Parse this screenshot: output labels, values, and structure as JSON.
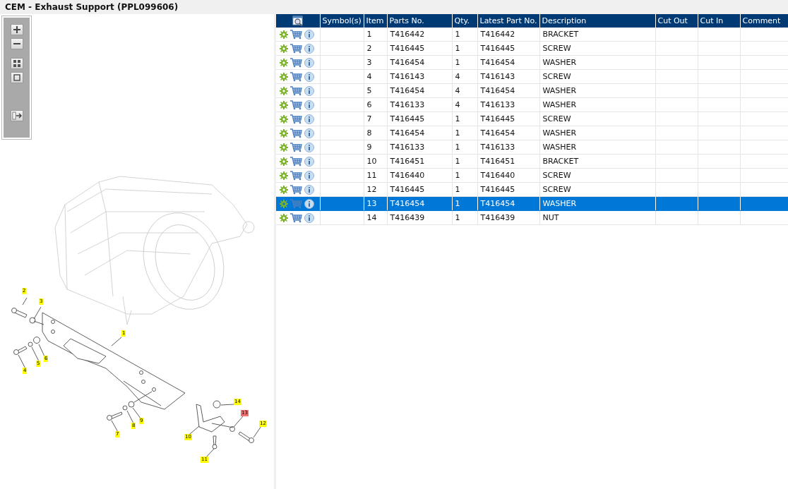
{
  "window": {
    "title": "CEM - Exhaust Support (PPL099606)"
  },
  "diagram": {
    "callouts": [
      {
        "label": "1",
        "selected": false
      },
      {
        "label": "2",
        "selected": false
      },
      {
        "label": "3",
        "selected": false
      },
      {
        "label": "4",
        "selected": false
      },
      {
        "label": "5",
        "selected": false
      },
      {
        "label": "6",
        "selected": false
      },
      {
        "label": "7",
        "selected": false
      },
      {
        "label": "8",
        "selected": false
      },
      {
        "label": "9",
        "selected": false
      },
      {
        "label": "10",
        "selected": false
      },
      {
        "label": "11",
        "selected": false
      },
      {
        "label": "12",
        "selected": false
      },
      {
        "label": "13",
        "selected": true
      },
      {
        "label": "14",
        "selected": false
      }
    ]
  },
  "table": {
    "columns": [
      "Symbol(s)",
      "Item",
      "Parts No.",
      "Qty.",
      "Latest Part No.",
      "Description",
      "Cut Out",
      "Cut In",
      "Comment"
    ],
    "rows": [
      {
        "item": "1",
        "part_no": "T416442",
        "qty": "1",
        "latest_part_no": "T416442",
        "description": "BRACKET",
        "selected": false
      },
      {
        "item": "2",
        "part_no": "T416445",
        "qty": "1",
        "latest_part_no": "T416445",
        "description": "SCREW",
        "selected": false
      },
      {
        "item": "3",
        "part_no": "T416454",
        "qty": "1",
        "latest_part_no": "T416454",
        "description": "WASHER",
        "selected": false
      },
      {
        "item": "4",
        "part_no": "T416143",
        "qty": "4",
        "latest_part_no": "T416143",
        "description": "SCREW",
        "selected": false
      },
      {
        "item": "5",
        "part_no": "T416454",
        "qty": "4",
        "latest_part_no": "T416454",
        "description": "WASHER",
        "selected": false
      },
      {
        "item": "6",
        "part_no": "T416133",
        "qty": "4",
        "latest_part_no": "T416133",
        "description": "WASHER",
        "selected": false
      },
      {
        "item": "7",
        "part_no": "T416445",
        "qty": "1",
        "latest_part_no": "T416445",
        "description": "SCREW",
        "selected": false
      },
      {
        "item": "8",
        "part_no": "T416454",
        "qty": "1",
        "latest_part_no": "T416454",
        "description": "WASHER",
        "selected": false
      },
      {
        "item": "9",
        "part_no": "T416133",
        "qty": "1",
        "latest_part_no": "T416133",
        "description": "WASHER",
        "selected": false
      },
      {
        "item": "10",
        "part_no": "T416451",
        "qty": "1",
        "latest_part_no": "T416451",
        "description": "BRACKET",
        "selected": false
      },
      {
        "item": "11",
        "part_no": "T416440",
        "qty": "1",
        "latest_part_no": "T416440",
        "description": "SCREW",
        "selected": false
      },
      {
        "item": "12",
        "part_no": "T416445",
        "qty": "1",
        "latest_part_no": "T416445",
        "description": "SCREW",
        "selected": false
      },
      {
        "item": "13",
        "part_no": "T416454",
        "qty": "1",
        "latest_part_no": "T416454",
        "description": "WASHER",
        "selected": true
      },
      {
        "item": "14",
        "part_no": "T416439",
        "qty": "1",
        "latest_part_no": "T416439",
        "description": "NUT",
        "selected": false
      }
    ]
  }
}
